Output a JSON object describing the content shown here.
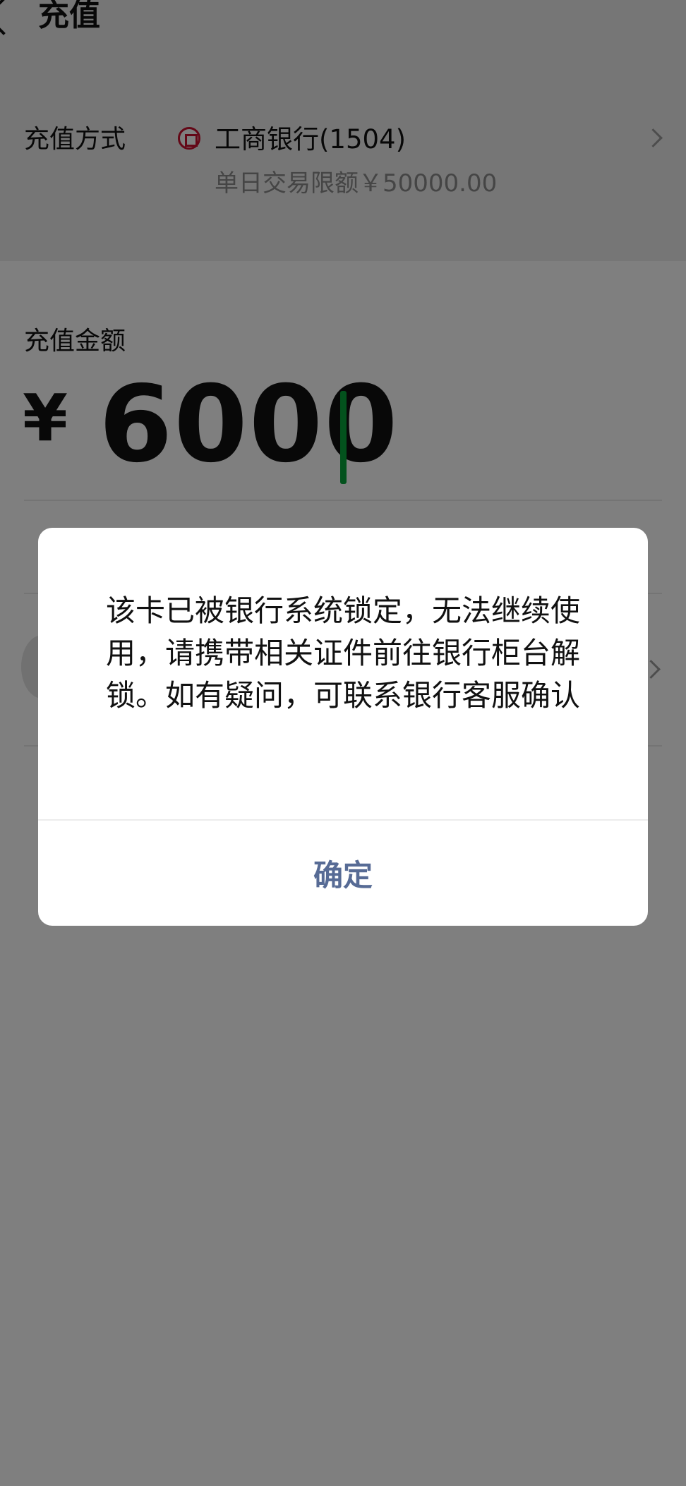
{
  "header": {
    "title": "充值"
  },
  "payment_method": {
    "label": "充值方式",
    "bank_name": "工商银行(1504)",
    "daily_limit": "单日交易限额￥50000.00"
  },
  "amount": {
    "label": "充值金额",
    "currency": "¥",
    "value": "6000"
  },
  "dialog": {
    "message": "该卡已被银行系统锁定，无法继续使用，请携带相关证件前往银行柜台解锁。如有疑问，可联系银行客服确认",
    "confirm_label": "确定"
  },
  "colors": {
    "caret": "#07a53b",
    "confirm_text": "#576b95",
    "bank_logo": "#c8102e"
  }
}
